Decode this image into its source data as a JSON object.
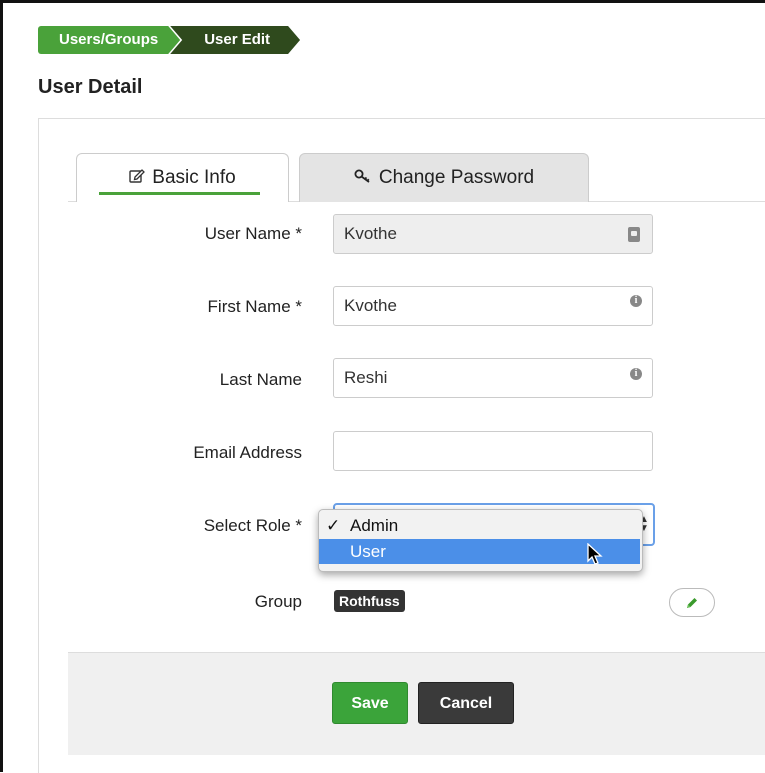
{
  "breadcrumb": {
    "items": [
      "Users/Groups",
      "User Edit"
    ]
  },
  "page_title": "User Detail",
  "tabs": [
    {
      "label": "Basic Info",
      "icon": "edit-icon",
      "active": true
    },
    {
      "label": "Change Password",
      "icon": "key-icon",
      "active": false
    }
  ],
  "form": {
    "user_name": {
      "label": "User Name *",
      "value": "Kvothe",
      "readonly": true,
      "icon": "book-icon"
    },
    "first_name": {
      "label": "First Name *",
      "value": "Kvothe",
      "icon": "info-icon"
    },
    "last_name": {
      "label": "Last Name",
      "value": "Reshi",
      "icon": "info-icon"
    },
    "email": {
      "label": "Email Address",
      "value": ""
    },
    "role": {
      "label": "Select Role *",
      "options": [
        "Admin",
        "User"
      ],
      "selected": "Admin",
      "highlighted": "User",
      "check_mark": "✓"
    },
    "group": {
      "label": "Group",
      "value": "Rothfuss"
    }
  },
  "buttons": {
    "save": "Save",
    "cancel": "Cancel"
  },
  "colors": {
    "accent_green": "#4aa23a",
    "dark_green": "#2f4a1d",
    "select_highlight": "#4b8fe8"
  }
}
